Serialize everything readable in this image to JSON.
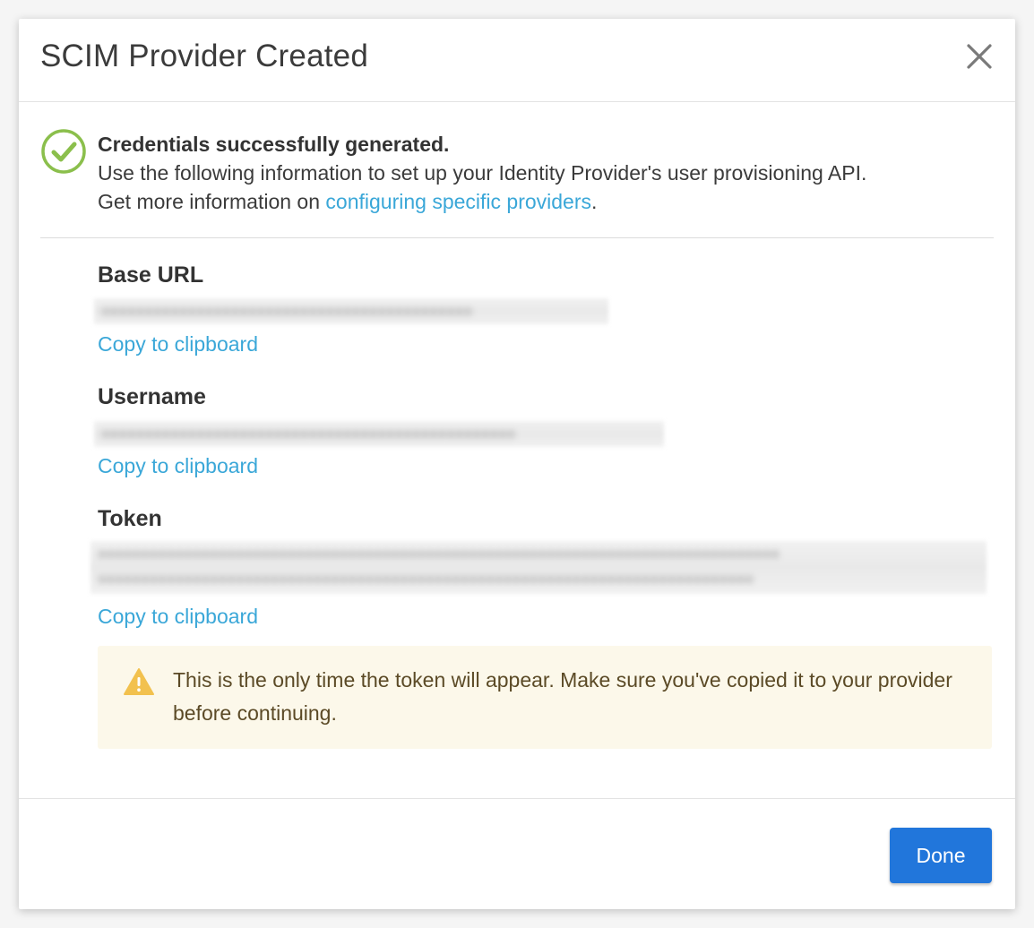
{
  "dialog": {
    "title": "SCIM Provider Created",
    "close_icon": "close-icon"
  },
  "success": {
    "icon": "check-circle-icon",
    "icon_color": "#8bbf4c",
    "title": "Credentials successfully generated.",
    "line1": "Use the following information to set up your Identity Provider's user provisioning API.",
    "line2_prefix": "Get more information on ",
    "link_text": "configuring specific providers",
    "line2_suffix": "."
  },
  "fields": {
    "base_url": {
      "label": "Base URL",
      "copy_label": "Copy to clipboard"
    },
    "username": {
      "label": "Username",
      "copy_label": "Copy to clipboard"
    },
    "token": {
      "label": "Token",
      "copy_label": "Copy to clipboard"
    }
  },
  "warning": {
    "icon": "warning-triangle-icon",
    "icon_color": "#f2c14e",
    "text": "This is the only time the token will appear. Make sure you've copied it to your provider before continuing."
  },
  "footer": {
    "done_label": "Done",
    "accent_color": "#2176db"
  },
  "colors": {
    "link": "#3aa7d8",
    "warning_bg": "#fcf8ea"
  }
}
